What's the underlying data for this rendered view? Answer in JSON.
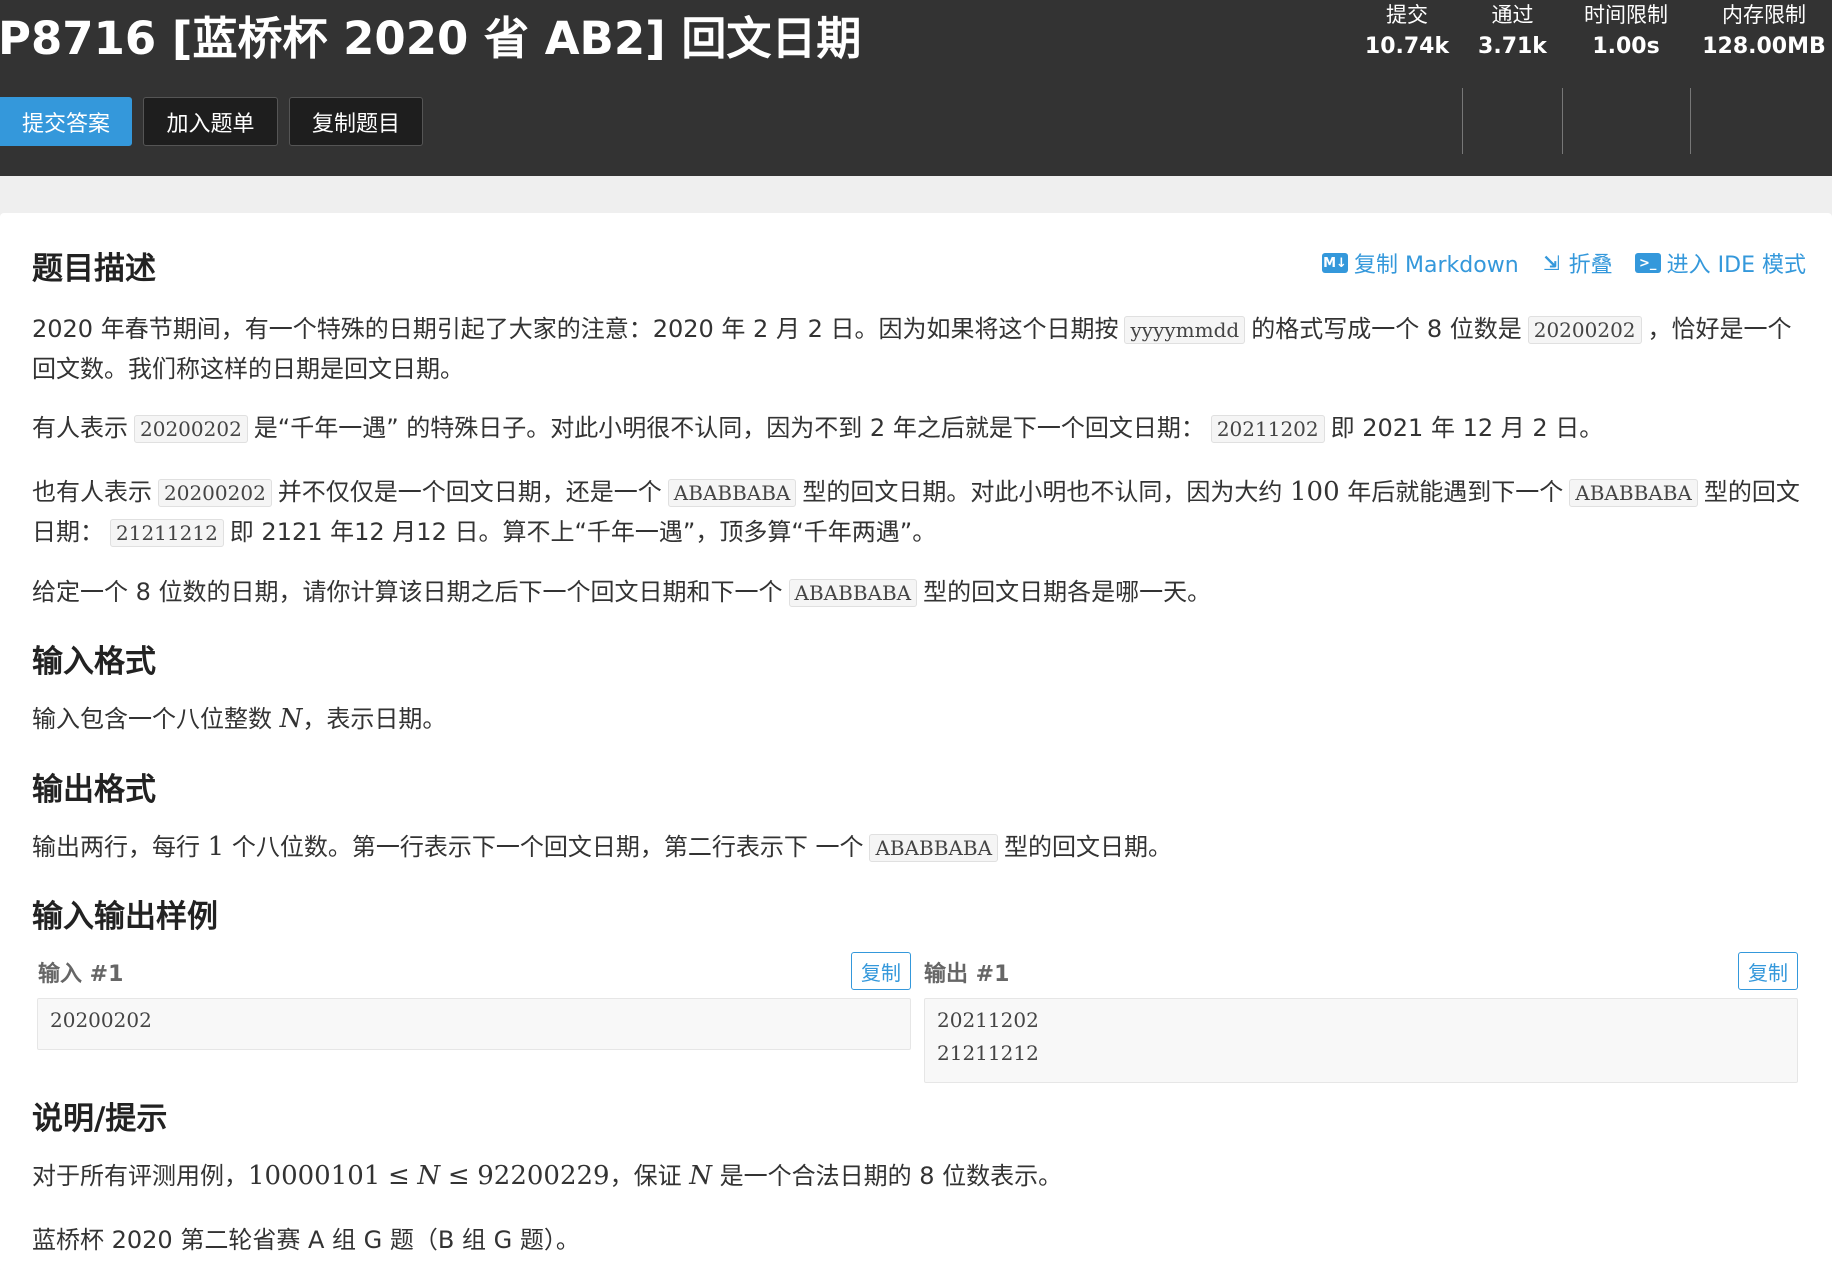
{
  "header": {
    "title": "P8716 [蓝桥杯 2020 省 AB2] 回文日期",
    "buttons": {
      "submit": "提交答案",
      "add_list": "加入题单",
      "copy_problem": "复制题目"
    },
    "stats": [
      {
        "label": "提交",
        "value": "10.74k"
      },
      {
        "label": "通过",
        "value": "3.71k"
      },
      {
        "label": "时间限制",
        "value": "1.00s"
      },
      {
        "label": "内存限制",
        "value": "128.00MB"
      }
    ]
  },
  "toolbar": {
    "copy_markdown": "复制 Markdown",
    "fold": "折叠",
    "ide_mode": "进入 IDE 模式",
    "md_icon": "M↓",
    "fold_icon": "⇲",
    "ide_icon": ">_"
  },
  "sections": {
    "description_title": "题目描述",
    "input_title": "输入格式",
    "output_title": "输出格式",
    "samples_title": "输入输出样例",
    "hint_title": "说明/提示"
  },
  "description": {
    "p1_a": "2020 年春节期间，有一个特殊的日期引起了大家的注意：2020 年 2 月 2 日。因为如果将这个日期按",
    "p1_code1": "yyyymmdd",
    "p1_b": "的格式写成一个 8 位数是",
    "p1_code2": "20200202",
    "p1_c": "，恰好是一个回文数。我们称这样的日期是回文日期。",
    "p2_a": "有人表示",
    "p2_code1": "20200202",
    "p2_b": "是“千年一遇” 的特殊日子。对此小明很不认同，因为不到 2 年之后就是下一个回文日期：",
    "p2_code2": "20211202",
    "p2_c": "即 2021 年 12 月 2 日。",
    "p3_a": "也有人表示",
    "p3_code1": "20200202",
    "p3_b": "并不仅仅是一个回文日期，还是一个",
    "p3_code2": "ABABBABA",
    "p3_c": "型的回文日期。对此小明也不认同，因为大约",
    "p3_num": "100",
    "p3_d": "年后就能遇到下一个",
    "p3_code3": "ABABBABA",
    "p3_e": "型的回文日期：",
    "p3_code4": "21211212",
    "p3_f": "即 2121 年12 月12 日。算不上“千年一遇”，顶多算“千年两遇”。",
    "p4_a": "给定一个 8 位数的日期，请你计算该日期之后下一个回文日期和下一个",
    "p4_code": "ABABBABA",
    "p4_b": "型的回文日期各是哪一天。"
  },
  "input_format": {
    "a": "输入包含一个八位整数",
    "var": "N",
    "b": "，表示日期。"
  },
  "output_format": {
    "a": "输出两行，每行",
    "num": "1",
    "b": "个八位数。第一行表示下一个回文日期，第二行表示下 一个",
    "code": "ABABBABA",
    "c": "型的回文日期。"
  },
  "samples": {
    "input_label": "输入 #1",
    "output_label": "输出 #1",
    "copy_label": "复制",
    "input_lines": [
      "20200202"
    ],
    "output_lines": [
      "20211202",
      "21211212"
    ]
  },
  "hint": {
    "a": "对于所有评测用例，",
    "lo": "10000101",
    "le1": "≤",
    "var": "N",
    "le2": "≤",
    "hi": "92200229",
    "b": "，保证",
    "var2": "N",
    "c": "是一个合法日期的 8 位数表示。",
    "source": "蓝桥杯 2020 第二轮省赛 A 组 G 题（B 组 G 题）。"
  }
}
